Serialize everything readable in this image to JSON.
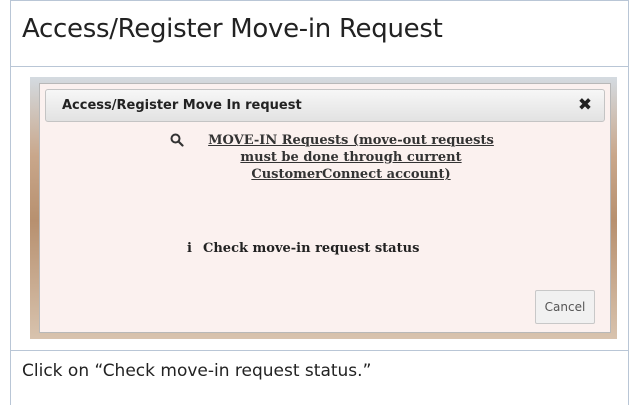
{
  "document": {
    "title": "Access/Register Move-in Request",
    "caption": "Click on “Check move-in request status.”"
  },
  "dialog": {
    "title": "Access/Register Move In request",
    "close_symbol": "✖",
    "move_in_link": "MOVE-IN Requests (move-out requests must be done through current CustomerConnect account)",
    "status_link": "Check move-in request status",
    "info_symbol": "i",
    "cancel_label": "Cancel"
  },
  "icons": {
    "search": "search-icon",
    "info": "info-icon",
    "close": "close-icon"
  }
}
